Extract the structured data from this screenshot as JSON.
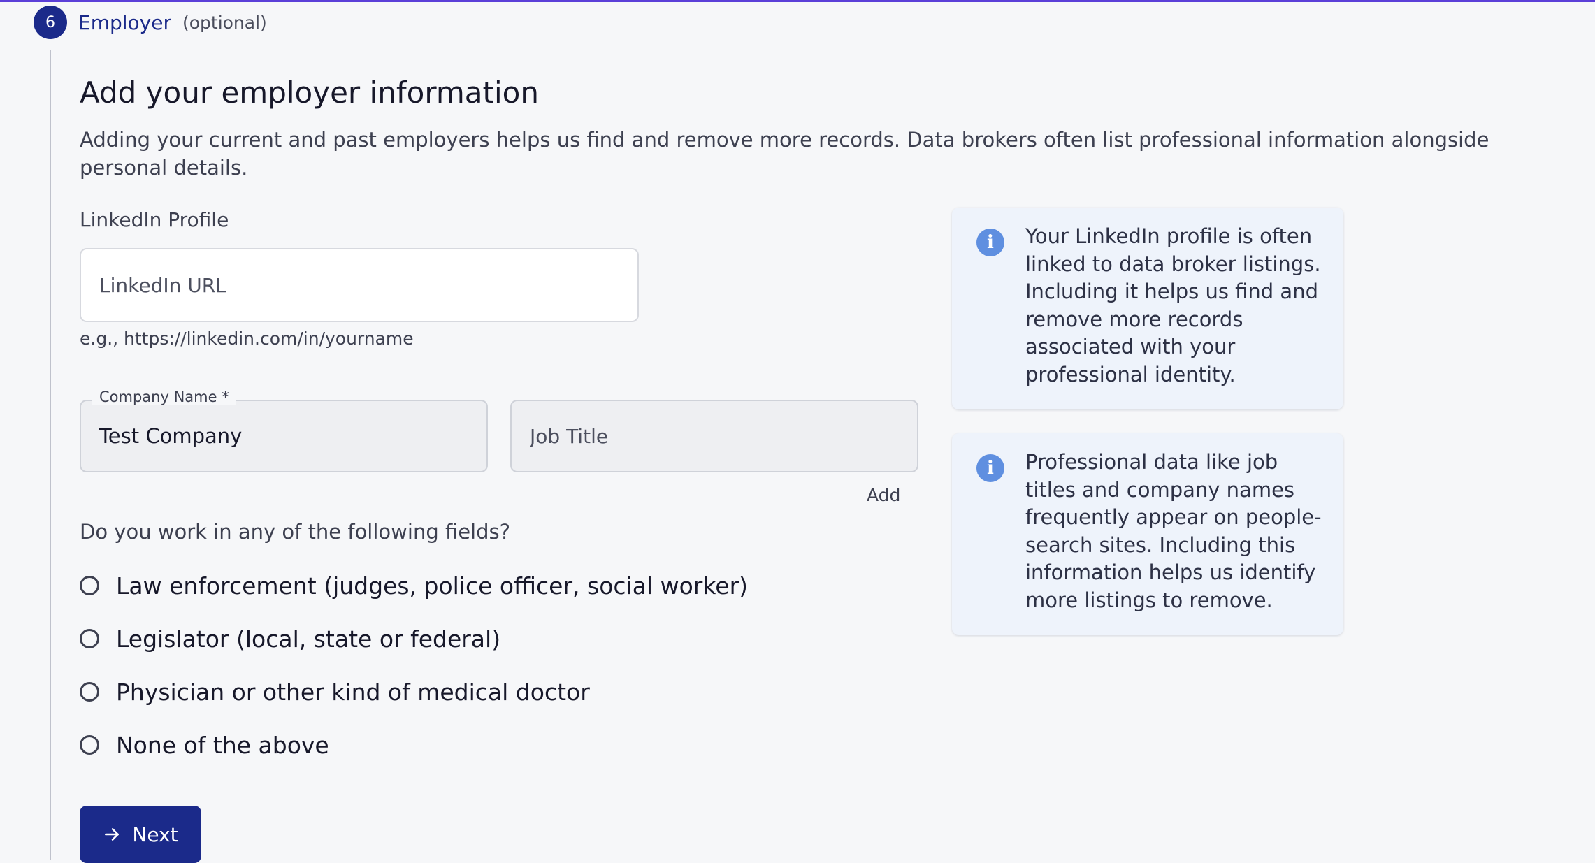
{
  "step": {
    "number": "6",
    "title": "Employer",
    "optional": "(optional)"
  },
  "section": {
    "title": "Add your employer information",
    "description": "Adding your current and past employers helps us find and remove more records. Data brokers often list professional information alongside personal details."
  },
  "linkedin": {
    "label": "LinkedIn Profile",
    "placeholder": "LinkedIn URL",
    "value": "",
    "helper": "e.g., https://linkedin.com/in/yourname"
  },
  "company": {
    "label": "Company Name *",
    "value": "Test Company"
  },
  "job_title": {
    "placeholder": "Job Title",
    "value": ""
  },
  "add_label": "Add",
  "fields_question": "Do you work in any of the following fields?",
  "fields_options": [
    {
      "label": "Law enforcement (judges, police officer, social worker)",
      "selected": false
    },
    {
      "label": "Legislator (local, state or federal)",
      "selected": false
    },
    {
      "label": "Physician or other kind of medical doctor",
      "selected": false
    },
    {
      "label": "None of the above",
      "selected": false
    }
  ],
  "next_button": {
    "label": "Next",
    "icon": "arrow-right-icon"
  },
  "info_cards": [
    {
      "icon": "info-icon",
      "text": "Your LinkedIn profile is often linked to data broker listings. Including it helps us find and remove more records associated with your professional identity."
    },
    {
      "icon": "info-icon",
      "text": "Professional data like job titles and company names frequently appear on people-search sites. Including this information helps us identify more listings to remove."
    }
  ],
  "colors": {
    "accent": "#1b2a8a",
    "top_line": "#5b3fd8",
    "info_icon": "#5f8fe0",
    "info_card_bg": "#eef3fb",
    "page_bg": "#f6f7f9"
  }
}
